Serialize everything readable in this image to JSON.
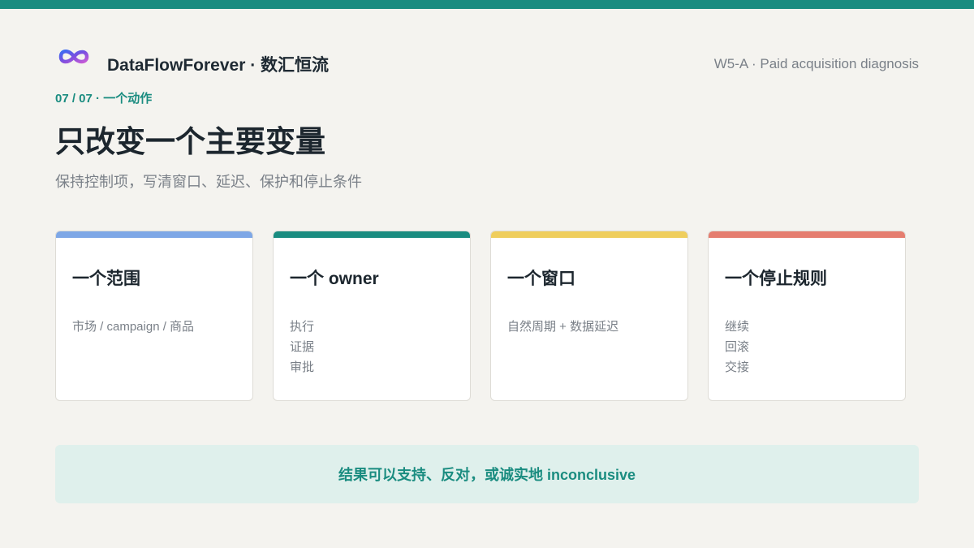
{
  "header": {
    "logo_icon": "infinity-logo-icon",
    "brand": "DataFlowForever · 数汇恒流",
    "deck_label": "W5-A · Paid acquisition diagnosis"
  },
  "section_label": "07 / 07 · 一个动作",
  "title": "只改变一个主要变量",
  "subtitle": "保持控制项，写清窗口、延迟、保护和停止条件",
  "cards": [
    {
      "title": "一个范围",
      "lines": [
        "市场 / campaign / 商品"
      ],
      "accent_color": "#7ea7e6"
    },
    {
      "title": "一个 owner",
      "lines": [
        "执行",
        "证据",
        "审批"
      ],
      "accent_color": "#1a8c80"
    },
    {
      "title": "一个窗口",
      "lines": [
        "自然周期 + 数据延迟"
      ],
      "accent_color": "#efce5d"
    },
    {
      "title": "一个停止规则",
      "lines": [
        "继续",
        "回滚",
        "交接"
      ],
      "accent_color": "#e57d6f"
    }
  ],
  "footer": "结果可以支持、反对，或诚实地 inconclusive",
  "colors": {
    "brand_teal": "#1a8c80",
    "background": "#f4f3ef",
    "footer_bg": "#dff0ec"
  }
}
